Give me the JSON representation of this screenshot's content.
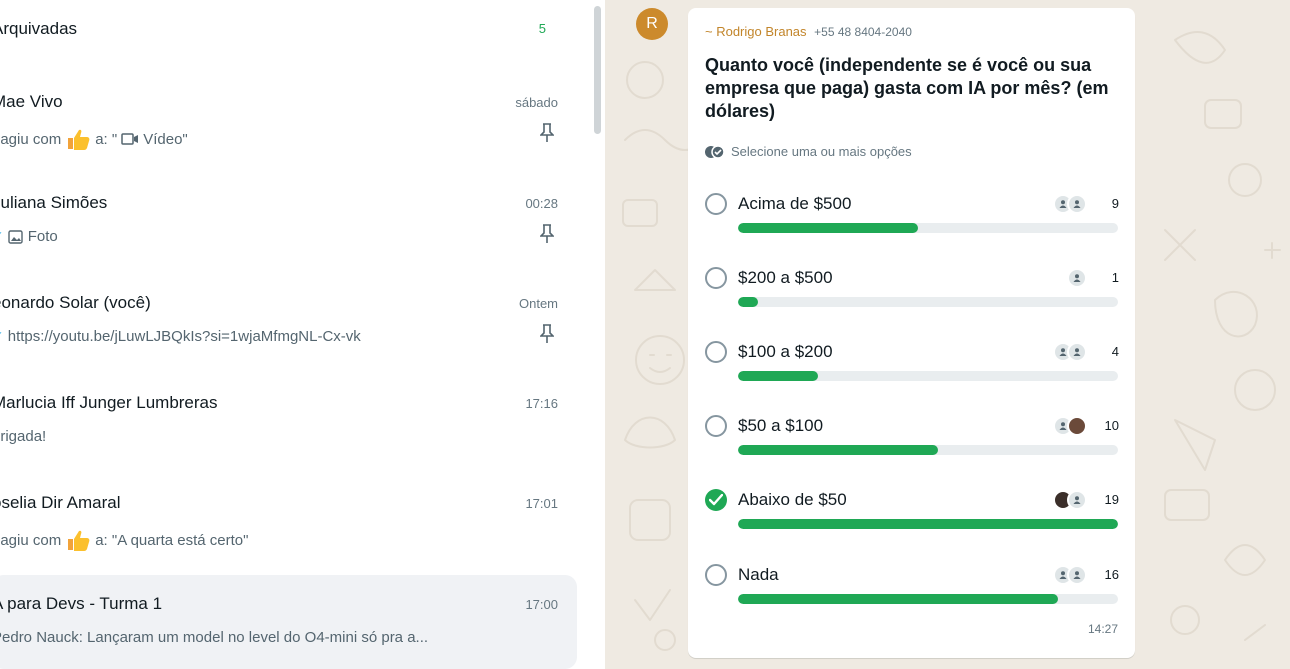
{
  "archived": {
    "label": "Arquivadas",
    "count": "5"
  },
  "chats": [
    {
      "name": "Mae Vivo",
      "time": "sábado",
      "preview_prefix": "eagiu com",
      "preview_text": "a: \"",
      "preview_media": "Vídeo\"",
      "pinned": true,
      "thumb": true,
      "icon": "video-icon"
    },
    {
      "name": "Juliana Simões",
      "time": "00:28",
      "preview_text": "Foto",
      "pinned": true,
      "tick": "✓",
      "icon": "image-icon"
    },
    {
      "name": "eonardo Solar (você)",
      "time": "Ontem",
      "preview_text": "https://youtu.be/jLuwLJBQkIs?si=1wjaMfmgNL-Cx-vk",
      "pinned": true,
      "tick": "✓"
    },
    {
      "name": "Marlucia Iff Junger Lumbreras",
      "time": "17:16",
      "preview_text": "brigada!"
    },
    {
      "name": "ôselia Dir Amaral",
      "time": "17:01",
      "preview_prefix": "eagiu com",
      "preview_text": "a: \"A quarta está certo\"",
      "thumb": true
    },
    {
      "name": "A para Devs - Turma 1",
      "time": "17:00",
      "preview_text": "Pedro Nauck: Lançaram um model no level do O4-mini só pra a...",
      "selected": true
    }
  ],
  "message": {
    "avatar_letter": "R",
    "sender_name": "~ Rodrigo Branas",
    "sender_phone": "+55 48 8404-2040",
    "question": "Quanto você (independente se é você ou sua empresa que paga) gasta com IA por mês? (em dólares)",
    "hint": "Selecione uma ou mais opções",
    "time": "14:27"
  },
  "poll": {
    "max_votes": 19,
    "options": [
      {
        "label": "Acima de $500",
        "votes": 9,
        "checked": false,
        "voters": [
          "default",
          "default"
        ]
      },
      {
        "label": "$200 a $500",
        "votes": 1,
        "checked": false,
        "voters": [
          "default"
        ]
      },
      {
        "label": "$100 a $200",
        "votes": 4,
        "checked": false,
        "voters": [
          "default",
          "default"
        ]
      },
      {
        "label": "$50 a $100",
        "votes": 10,
        "checked": false,
        "voters": [
          "default",
          "photo"
        ]
      },
      {
        "label": "Abaixo de $50",
        "votes": 19,
        "checked": true,
        "voters": [
          "photo2",
          "default"
        ]
      },
      {
        "label": "Nada",
        "votes": 16,
        "checked": false,
        "voters": [
          "default",
          "default"
        ]
      }
    ]
  },
  "colors": {
    "accent_green": "#1fa855",
    "sender_color": "#c2852a",
    "wallpaper": "#efeae2",
    "selected_row": "#f0f2f5"
  }
}
